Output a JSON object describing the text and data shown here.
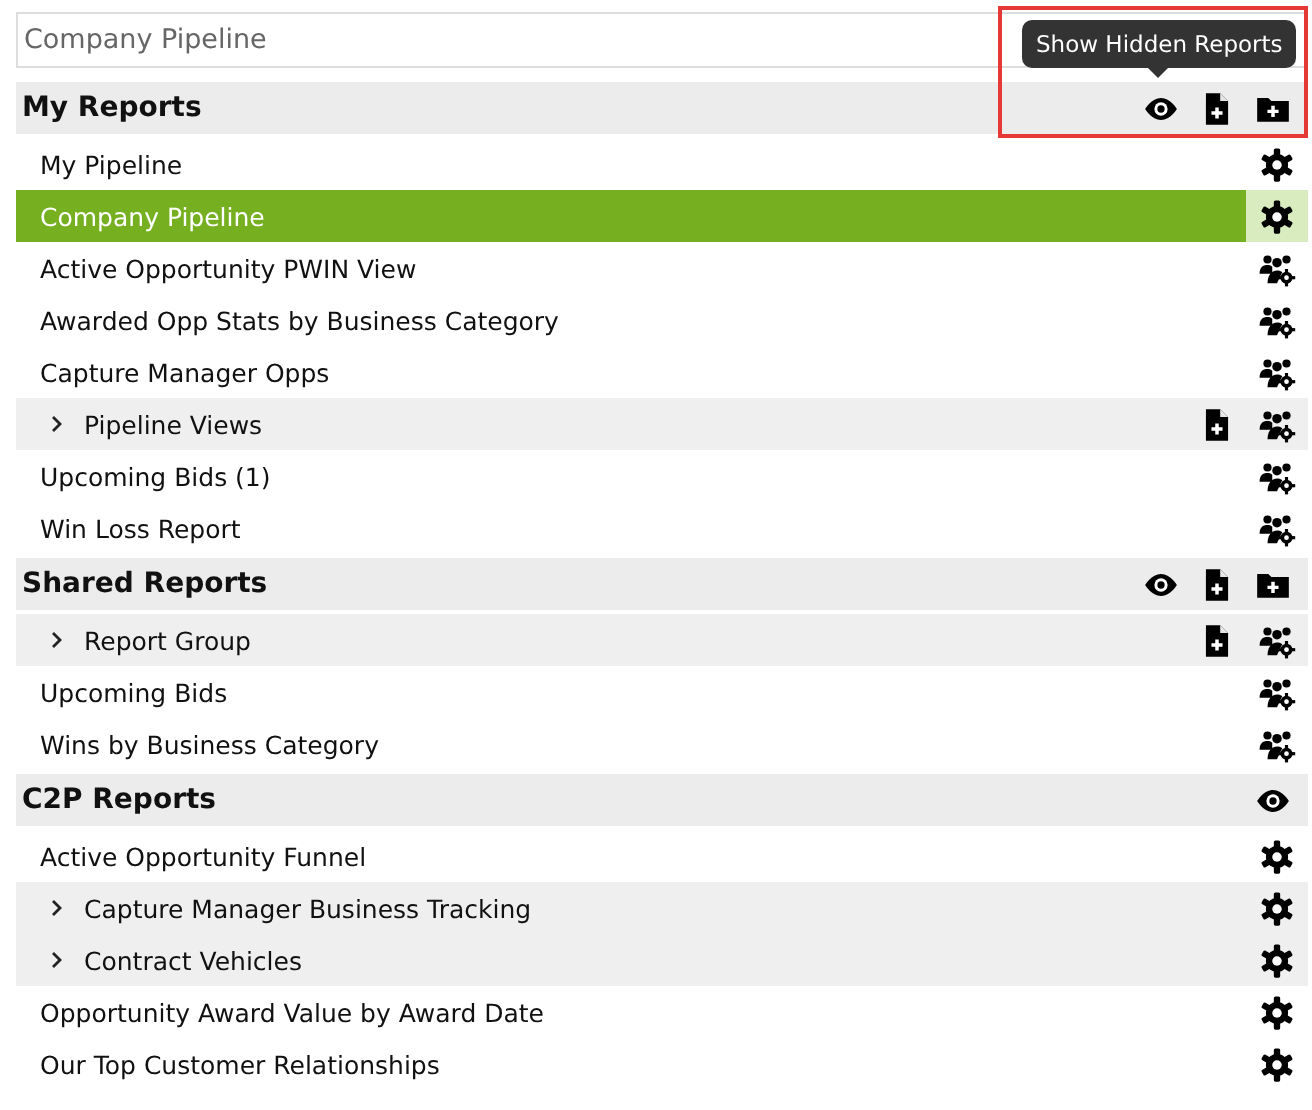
{
  "report_select": {
    "value": "Company Pipeline"
  },
  "tooltip": {
    "text": "Show Hidden Reports"
  },
  "highlight_frame": {
    "shown": true
  },
  "sections": [
    {
      "title": "My Reports",
      "actions": [
        {
          "kind": "eye"
        },
        {
          "kind": "file_plus"
        },
        {
          "kind": "folder_plus"
        }
      ],
      "items": [
        {
          "kind": "report",
          "label": "My Pipeline",
          "selected": false,
          "icons": [
            {
              "kind": "gear"
            }
          ]
        },
        {
          "kind": "report",
          "label": "Company Pipeline",
          "selected": true,
          "icons": [
            {
              "kind": "gear"
            }
          ]
        },
        {
          "kind": "report",
          "label": "Active Opportunity PWIN View",
          "selected": false,
          "icons": [
            {
              "kind": "users_gear"
            }
          ]
        },
        {
          "kind": "report",
          "label": "Awarded Opp Stats by Business Category",
          "selected": false,
          "icons": [
            {
              "kind": "users_gear"
            }
          ]
        },
        {
          "kind": "report",
          "label": "Capture Manager Opps",
          "selected": false,
          "icons": [
            {
              "kind": "users_gear"
            }
          ]
        },
        {
          "kind": "group",
          "label": "Pipeline Views",
          "expanded": false,
          "selected": false,
          "icons": [
            {
              "kind": "file_plus"
            },
            {
              "kind": "users_gear"
            }
          ]
        },
        {
          "kind": "report",
          "label": "Upcoming Bids (1)",
          "selected": false,
          "icons": [
            {
              "kind": "users_gear"
            }
          ]
        },
        {
          "kind": "report",
          "label": "Win Loss Report",
          "selected": false,
          "icons": [
            {
              "kind": "users_gear"
            }
          ]
        }
      ]
    },
    {
      "title": "Shared Reports",
      "actions": [
        {
          "kind": "eye"
        },
        {
          "kind": "file_plus"
        },
        {
          "kind": "folder_plus"
        }
      ],
      "items": [
        {
          "kind": "group",
          "label": "Report Group",
          "expanded": false,
          "selected": false,
          "icons": [
            {
              "kind": "file_plus"
            },
            {
              "kind": "users_gear"
            }
          ]
        },
        {
          "kind": "report",
          "label": "Upcoming Bids",
          "selected": false,
          "icons": [
            {
              "kind": "users_gear"
            }
          ]
        },
        {
          "kind": "report",
          "label": "Wins by Business Category",
          "selected": false,
          "icons": [
            {
              "kind": "users_gear"
            }
          ]
        }
      ]
    },
    {
      "title": "C2P Reports",
      "actions": [
        {
          "kind": "eye"
        }
      ],
      "items": [
        {
          "kind": "report",
          "label": "Active Opportunity Funnel",
          "selected": false,
          "icons": [
            {
              "kind": "gear"
            }
          ]
        },
        {
          "kind": "group",
          "label": "Capture Manager Business Tracking",
          "expanded": false,
          "selected": false,
          "icons": [
            {
              "kind": "gear"
            }
          ]
        },
        {
          "kind": "group",
          "label": "Contract Vehicles",
          "expanded": false,
          "selected": false,
          "icons": [
            {
              "kind": "gear"
            }
          ]
        },
        {
          "kind": "report",
          "label": "Opportunity Award Value by Award Date",
          "selected": false,
          "icons": [
            {
              "kind": "gear"
            }
          ]
        },
        {
          "kind": "report",
          "label": "Our Top Customer Relationships",
          "selected": false,
          "icons": [
            {
              "kind": "gear"
            }
          ]
        }
      ]
    }
  ]
}
